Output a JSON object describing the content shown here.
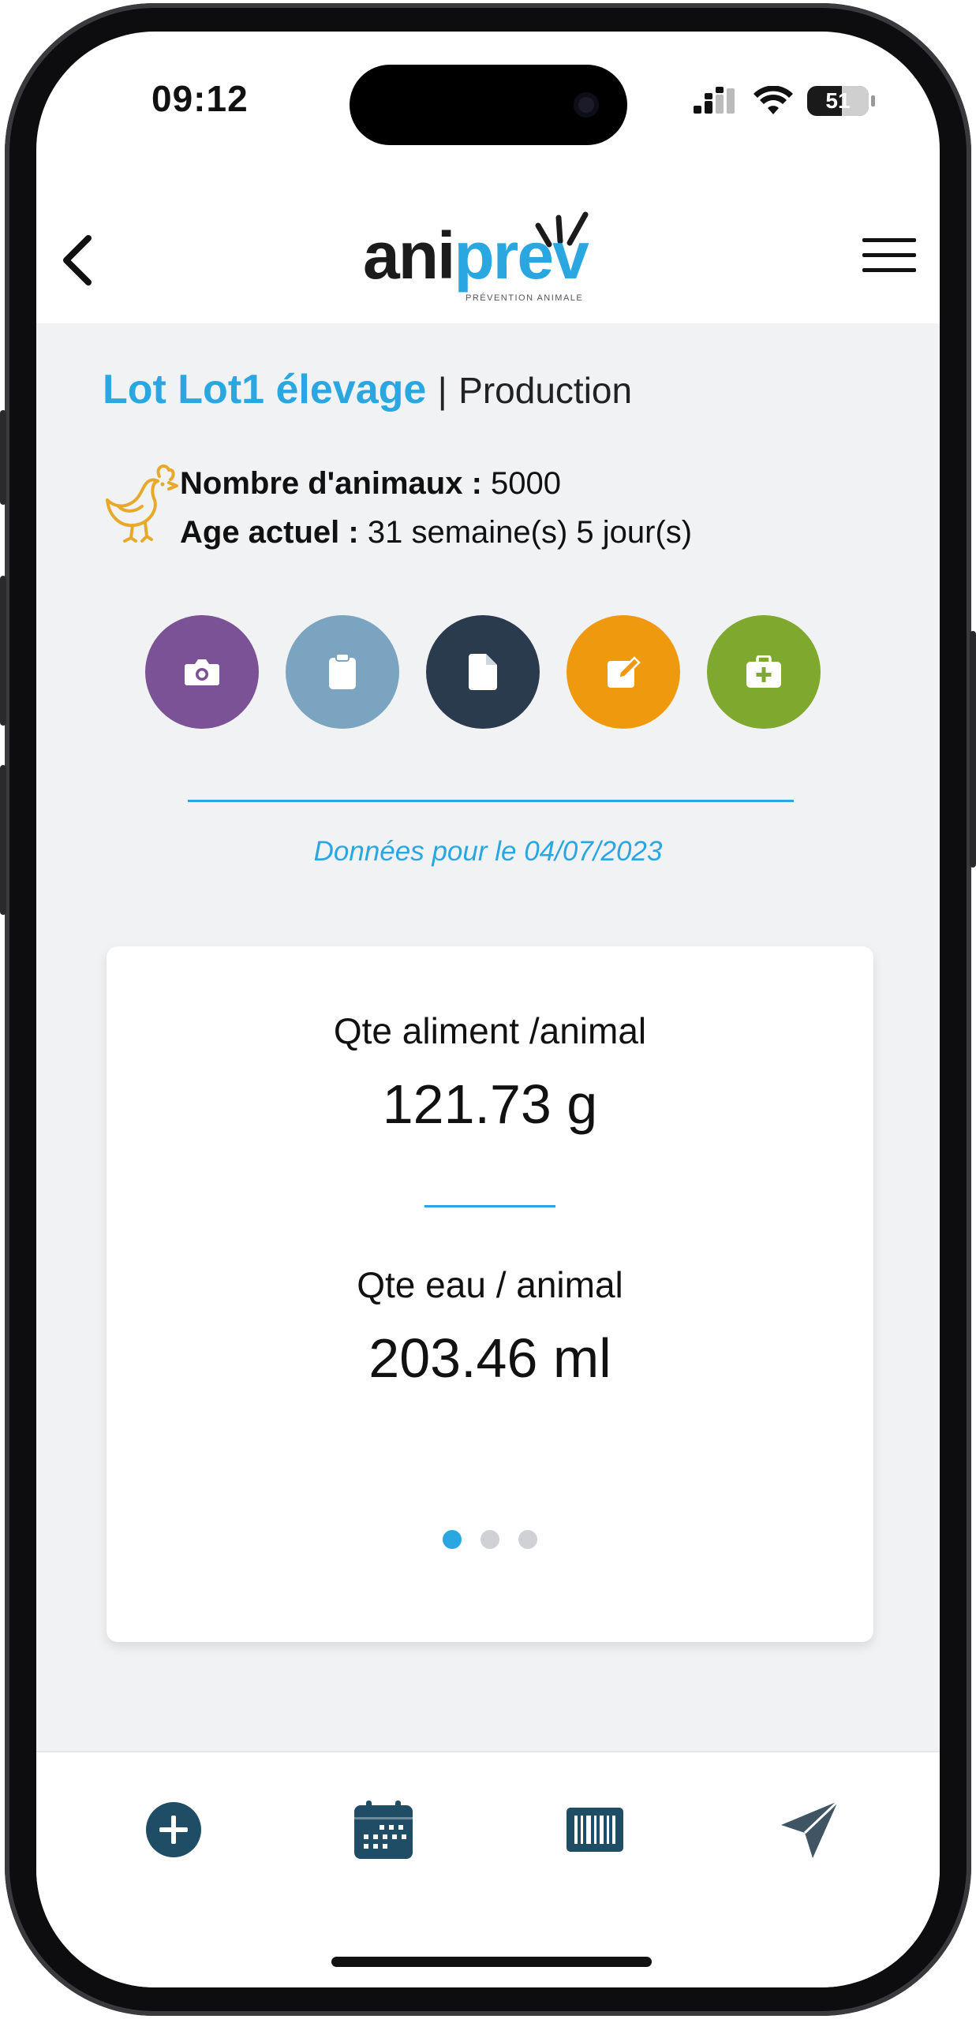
{
  "status_bar": {
    "time": "09:12",
    "battery": "51"
  },
  "header": {
    "logo_primary": "ani",
    "logo_accent": "prev",
    "logo_tagline": "PRÉVENTION ANIMALE"
  },
  "lot": {
    "name": "Lot Lot1 élevage",
    "separator": "|",
    "category": "Production"
  },
  "info": {
    "animals_label": "Nombre d'animaux :",
    "animals_value": "5000",
    "age_label": "Age actuel :",
    "age_value": "31 semaine(s) 5 jour(s)"
  },
  "actions": [
    {
      "icon": "camera-icon",
      "color": "#7b5296"
    },
    {
      "icon": "clipboard-icon",
      "color": "#7aa4c0"
    },
    {
      "icon": "document-icon",
      "color": "#2b3b4e"
    },
    {
      "icon": "edit-note-icon",
      "color": "#ef9a0e"
    },
    {
      "icon": "medical-kit-icon",
      "color": "#7fa82e"
    }
  ],
  "date_label": "Données pour le 04/07/2023",
  "card": {
    "metric1_label": "Qte aliment /animal",
    "metric1_value": "121.73 g",
    "metric2_label": "Qte eau / animal",
    "metric2_value": "203.46 ml",
    "pages": 3,
    "active_page": 1
  },
  "bottom_nav": [
    {
      "icon": "add-circle-icon"
    },
    {
      "icon": "calendar-icon"
    },
    {
      "icon": "barcode-icon"
    },
    {
      "icon": "send-icon"
    }
  ],
  "colors": {
    "accent": "#2aa7e0",
    "nav_icon": "#1f4d66",
    "background": "#f1f2f4"
  }
}
